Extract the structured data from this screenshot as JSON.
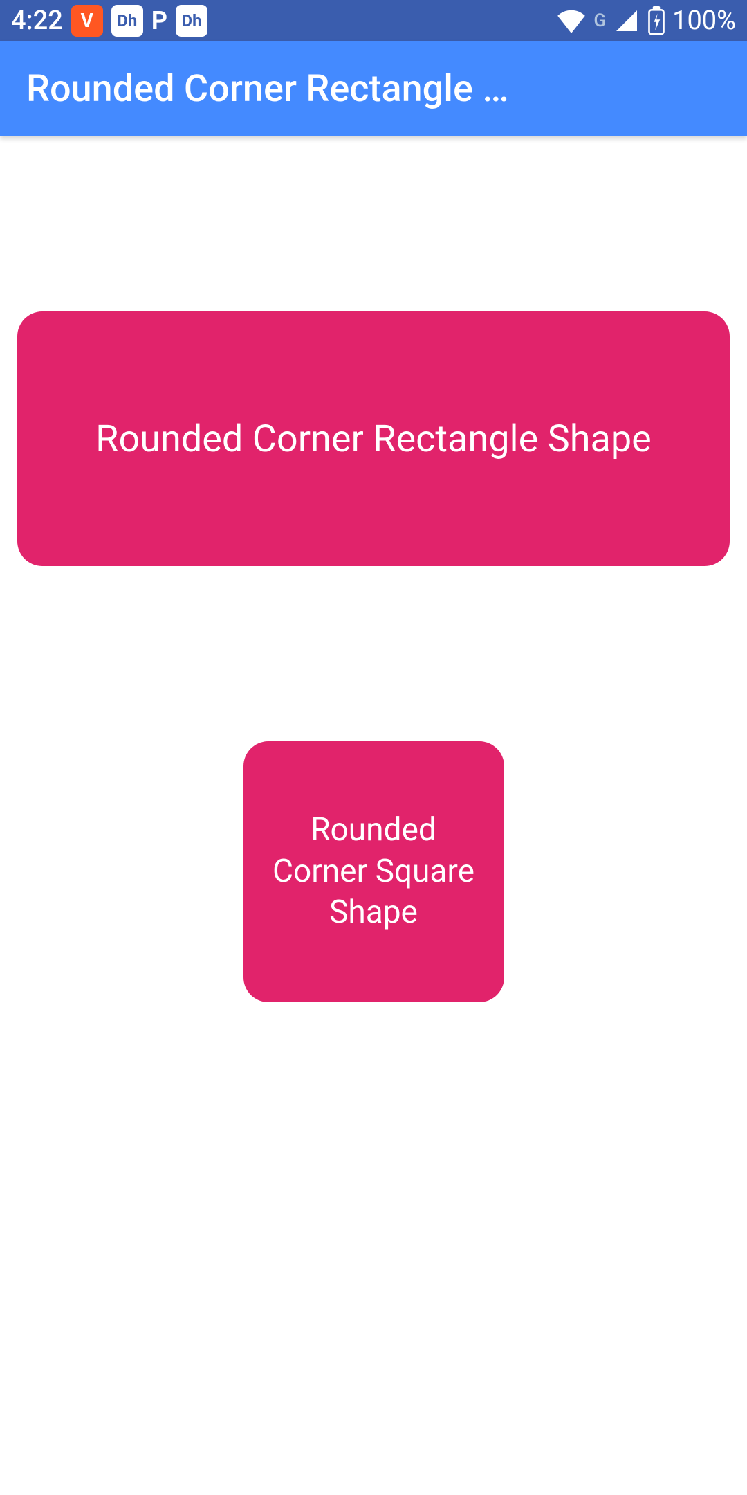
{
  "statusBar": {
    "time": "4:22",
    "batteryText": "100%",
    "gLabel": "G"
  },
  "appBar": {
    "title": "Rounded Corner Rectangle …"
  },
  "shapes": {
    "rectangle": {
      "label": "Rounded Corner Rectangle Shape"
    },
    "square": {
      "label": "Rounded Corner Square Shape"
    }
  }
}
